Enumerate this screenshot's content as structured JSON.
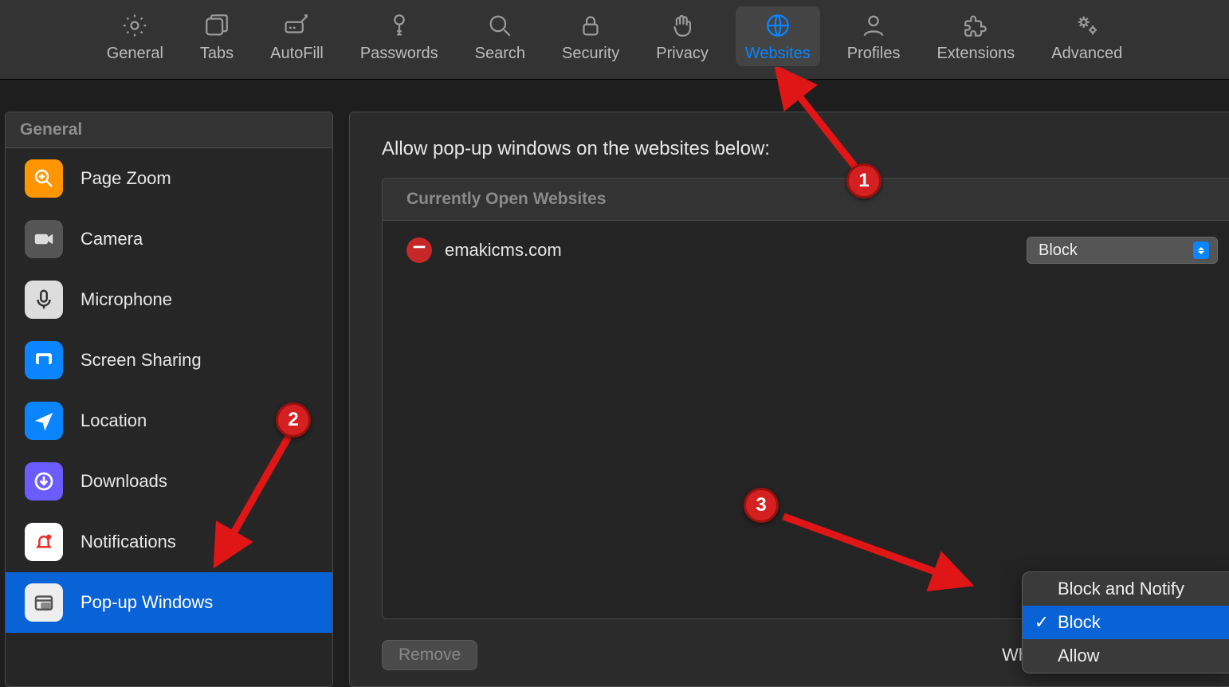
{
  "toolbar": {
    "items": [
      {
        "label": "General"
      },
      {
        "label": "Tabs"
      },
      {
        "label": "AutoFill"
      },
      {
        "label": "Passwords"
      },
      {
        "label": "Search"
      },
      {
        "label": "Security"
      },
      {
        "label": "Privacy"
      },
      {
        "label": "Websites"
      },
      {
        "label": "Profiles"
      },
      {
        "label": "Extensions"
      },
      {
        "label": "Advanced"
      }
    ],
    "selected_index": 7
  },
  "sidebar": {
    "header": "General",
    "items": [
      {
        "label": "Page Zoom"
      },
      {
        "label": "Camera"
      },
      {
        "label": "Microphone"
      },
      {
        "label": "Screen Sharing"
      },
      {
        "label": "Location"
      },
      {
        "label": "Downloads"
      },
      {
        "label": "Notifications"
      },
      {
        "label": "Pop-up Windows"
      }
    ],
    "selected_index": 7
  },
  "main": {
    "title": "Allow pop-up windows on the websites below:",
    "currently_open_header": "Currently Open Websites",
    "sites": [
      {
        "domain": "emakicms.com",
        "policy": "Block"
      }
    ],
    "remove_label": "Remove",
    "other_label": "When visiting other websites:"
  },
  "popup": {
    "options": [
      {
        "label": "Block and Notify"
      },
      {
        "label": "Block"
      },
      {
        "label": "Allow"
      }
    ],
    "selected_index": 1
  },
  "annotations": {
    "badge1": "1",
    "badge2": "2",
    "badge3": "3"
  }
}
